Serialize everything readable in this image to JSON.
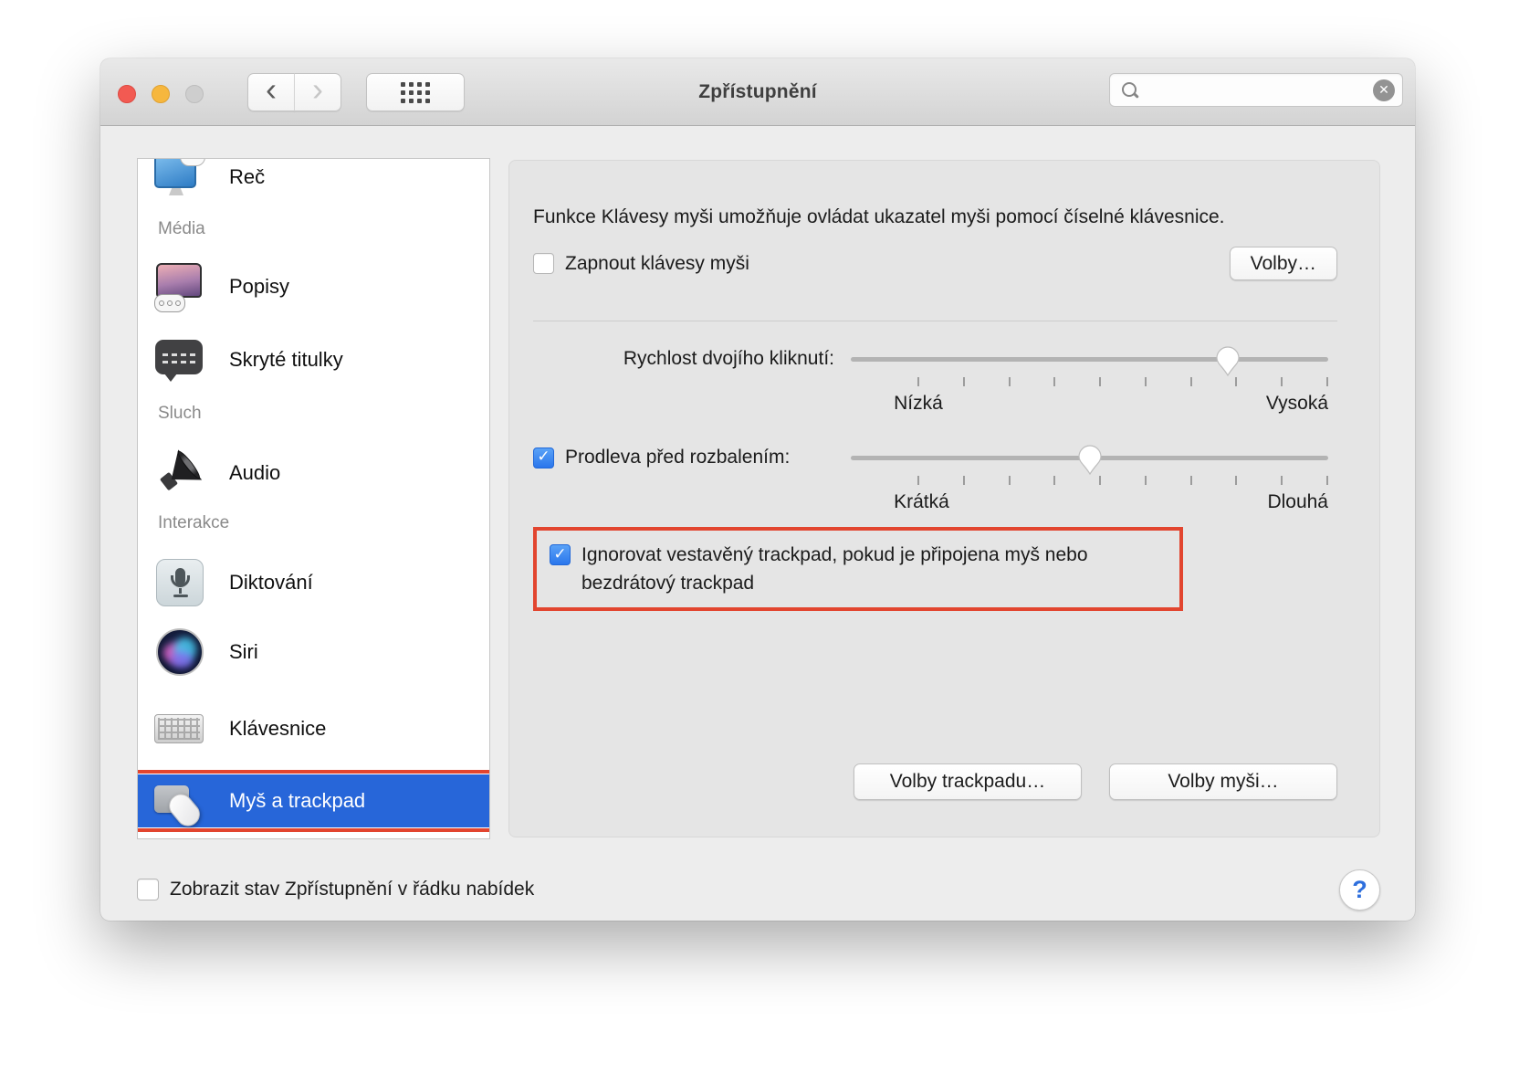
{
  "window": {
    "title": "Zpřístupnění"
  },
  "titlebar": {
    "search_value": "",
    "search_placeholder": ""
  },
  "icons": {
    "back_chevron": "‹",
    "forward_chevron": "›",
    "clear_glyph": "✕",
    "check_glyph": "✓",
    "help_glyph": "?"
  },
  "sidebar": {
    "items": [
      {
        "label": "Reč",
        "type": "item",
        "icon": "speech-monitor-icon"
      },
      {
        "label": "Média",
        "type": "header"
      },
      {
        "label": "Popisy",
        "type": "item",
        "icon": "descriptions-monitor-icon"
      },
      {
        "label": "Skryté titulky",
        "type": "item",
        "icon": "captions-bubble-icon"
      },
      {
        "label": "Sluch",
        "type": "header"
      },
      {
        "label": "Audio",
        "type": "item",
        "icon": "speaker-icon"
      },
      {
        "label": "Interakce",
        "type": "header"
      },
      {
        "label": "Diktování",
        "type": "item",
        "icon": "microphone-icon"
      },
      {
        "label": "Siri",
        "type": "item",
        "icon": "siri-orb-icon"
      },
      {
        "label": "Klávesnice",
        "type": "item",
        "icon": "keyboard-icon"
      },
      {
        "label": "Myš a trackpad",
        "type": "item",
        "icon": "mouse-trackpad-icon",
        "selected": true,
        "annotated": true
      }
    ]
  },
  "main": {
    "intro": "Funkce Klávesy myši umožňuje ovládat ukazatel myši pomocí číselné klávesnice.",
    "mouse_keys": {
      "label": "Zapnout klávesy myši",
      "checked": false,
      "options_button": "Volby…"
    },
    "double_click": {
      "label": "Rychlost dvojího kliknutí:",
      "min_label": "Nízká",
      "max_label": "Vysoká",
      "value_percent": 79,
      "tick_count": 10
    },
    "spring_delay": {
      "label": "Prodleva před rozbalením:",
      "checked": true,
      "min_label": "Krátká",
      "max_label": "Dlouhá",
      "value_percent": 50,
      "tick_count": 10
    },
    "ignore_trackpad": {
      "label": "Ignorovat vestavěný trackpad, pokud je připojena myš nebo bezdrátový trackpad",
      "checked": true,
      "annotated": true
    },
    "trackpad_options_button": "Volby trackpadu…",
    "mouse_options_button": "Volby myši…"
  },
  "footer": {
    "show_status_label": "Zobrazit stav Zpřístupnění v řádku nabídek",
    "checked": false
  },
  "colors": {
    "selection_blue": "#2766d9",
    "annotation_red": "#e2452f",
    "checkbox_blue": "#2a76ec",
    "window_background": "#ededed",
    "panel_background": "#e5e5e5"
  }
}
